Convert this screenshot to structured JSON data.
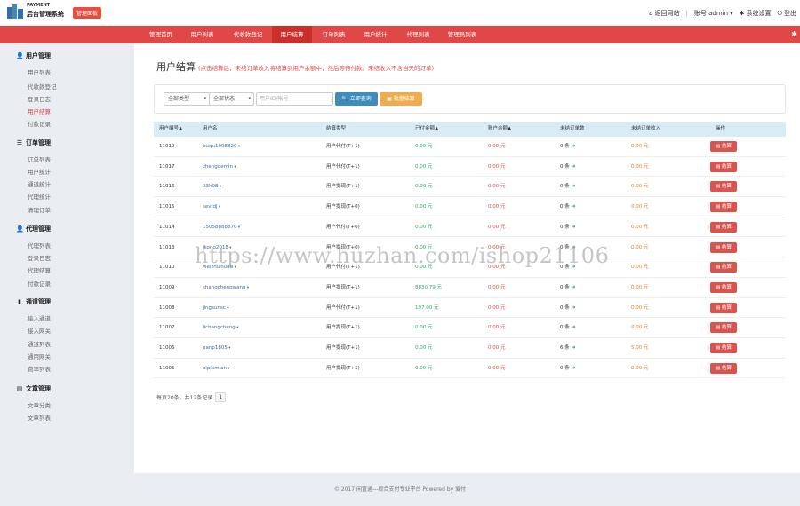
{
  "header": {
    "brand_sub": "PAYMENT",
    "brand": "后台管理系统",
    "badge": "管理面板",
    "links": {
      "home": "返回网站",
      "account": "账号 admin",
      "settings": "系统设置",
      "logout": "登出"
    }
  },
  "nav": {
    "tabs": [
      "管理首页",
      "用户列表",
      "代收款登记",
      "用户结算",
      "订单列表",
      "用户统计",
      "代理列表",
      "管理员列表"
    ],
    "active_index": 3
  },
  "sidebar": {
    "groups": [
      {
        "title": "用户管理",
        "icon": "user-icon",
        "items": [
          "用户列表",
          "代收款登记",
          "登录日志",
          "用户结算",
          "付款记录"
        ]
      },
      {
        "title": "订单管理",
        "icon": "list-icon",
        "items": [
          "订单列表",
          "用户统计",
          "通道统计",
          "代理统计",
          "清理订单"
        ]
      },
      {
        "title": "代理管理",
        "icon": "user-icon",
        "items": [
          "代理列表",
          "登录日志",
          "代理结算",
          "付款记录"
        ]
      },
      {
        "title": "通道管理",
        "icon": "signal-icon",
        "items": [
          "接入通道",
          "接入网关",
          "通道列表",
          "通用网关",
          "费率列表"
        ]
      },
      {
        "title": "文章管理",
        "icon": "book-icon",
        "items": [
          "文章分类",
          "文章列表"
        ]
      }
    ],
    "active_item": "用户结算"
  },
  "main": {
    "title": "用户结算",
    "note": "(点击结算后，未结订单收入将结算到用户余额中，然后等待付款。未结收入不含当天的订单)",
    "filters": {
      "select1": "全部类型",
      "select2": "全部状态",
      "search_placeholder": "用户ID/帐号",
      "query_button": "立即查询",
      "batch_button": "批量结算"
    },
    "table": {
      "headers": [
        "用户编号▲",
        "用户名",
        "结算类型",
        "已付金额▲",
        "账户余额▲",
        "未结订单数",
        "未结订单收入",
        "操作"
      ],
      "rows": [
        {
          "id": "11019",
          "name": "huqu1098820",
          "type": "用户代付(T+1)",
          "paid": "0.00 元",
          "balance": "0.00 元",
          "count": "0 条",
          "income": "0.00 元",
          "op": "结算"
        },
        {
          "id": "11017",
          "name": "zhengdemin",
          "type": "用户代付(T+1)",
          "paid": "0.00 元",
          "balance": "0.00 元",
          "count": "0 条",
          "income": "0.00 元",
          "op": "结算"
        },
        {
          "id": "11016",
          "name": "23h98",
          "type": "用户提现(T+1)",
          "paid": "0.00 元",
          "balance": "0.00 元",
          "count": "0 条",
          "income": "0.00 元",
          "op": "结算"
        },
        {
          "id": "11015",
          "name": "sevfdj",
          "type": "用户提现(T+0)",
          "paid": "0.00 元",
          "balance": "0.00 元",
          "count": "0 条",
          "income": "0.00 元",
          "op": "结算"
        },
        {
          "id": "11014",
          "name": "15058888870",
          "type": "用户代付(T+0)",
          "paid": "0.00 元",
          "balance": "0.00 元",
          "count": "0 条",
          "income": "0.00 元",
          "op": "结算"
        },
        {
          "id": "11013",
          "name": "jkong2018",
          "type": "用户提现(T+0)",
          "paid": "0.00 元",
          "balance": "0.00 元",
          "count": "0 条",
          "income": "0.00 元",
          "op": "结算"
        },
        {
          "id": "11010",
          "name": "weizhizhu88",
          "type": "用户代付(T+1)",
          "paid": "0.00 元",
          "balance": "0.00 元",
          "count": "0 条",
          "income": "0.00 元",
          "op": "结算"
        },
        {
          "id": "11009",
          "name": "shangchengwang",
          "type": "用户提现(T+1)",
          "paid": "8830.79 元",
          "balance": "0.00 元",
          "count": "0 条",
          "income": "0.00 元",
          "op": "结算"
        },
        {
          "id": "11008",
          "name": "jingsunsc",
          "type": "用户代付(T+1)",
          "paid": "197.00 元",
          "balance": "0.00 元",
          "count": "0 条",
          "income": "0.00 元",
          "op": "结算"
        },
        {
          "id": "11007",
          "name": "lichangcheng",
          "type": "用户提现(T+1)",
          "paid": "0.00 元",
          "balance": "0.00 元",
          "count": "0 条",
          "income": "0.00 元",
          "op": "结算"
        },
        {
          "id": "11006",
          "name": "nanp1805",
          "type": "用户提现(T+1)",
          "paid": "0.00 元",
          "balance": "0.00 元",
          "count": "6 条",
          "income": "5.00 元",
          "op": "结算"
        },
        {
          "id": "11005",
          "name": "xiplumian",
          "type": "用户提现(T+1)",
          "paid": "0.00 元",
          "balance": "0.00 元",
          "count": "0 条",
          "income": "0.00 元",
          "op": "结算"
        }
      ]
    },
    "pager": {
      "summary": "每页20条，共12条记录",
      "current": "1"
    }
  },
  "footer": {
    "text": "© 2017 闲置通---综合支付专业平台 Powered by 爱付"
  },
  "watermark": "https://www.huzhan.com/ishop21106"
}
